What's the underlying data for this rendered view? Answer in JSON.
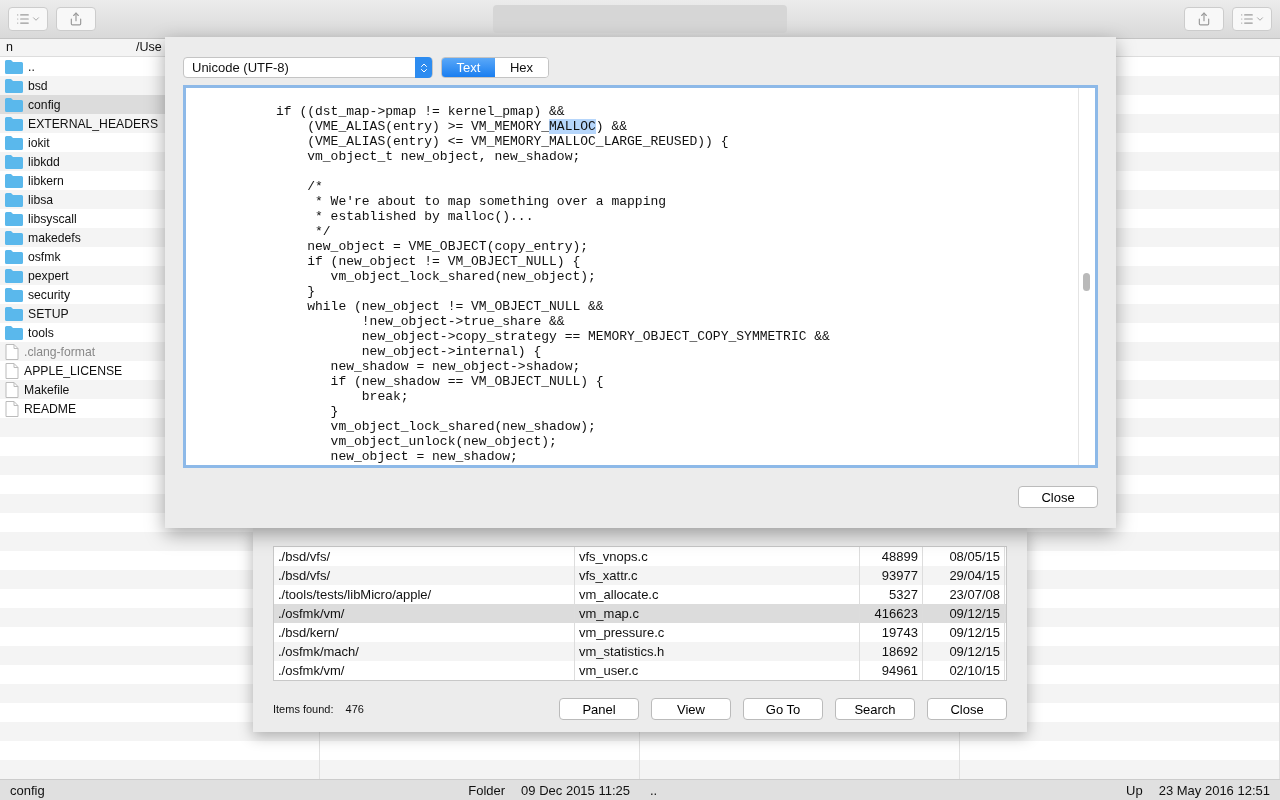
{
  "panel": {
    "header": {
      "name": "n",
      "path": "/Use"
    },
    "items": [
      {
        "kind": "folder",
        "name": "..",
        "selected": false,
        "hidden": false
      },
      {
        "kind": "folder",
        "name": "bsd",
        "selected": false,
        "hidden": false
      },
      {
        "kind": "folder",
        "name": "config",
        "selected": true,
        "hidden": false
      },
      {
        "kind": "folder",
        "name": "EXTERNAL_HEADERS",
        "selected": false,
        "hidden": false
      },
      {
        "kind": "folder",
        "name": "iokit",
        "selected": false,
        "hidden": false
      },
      {
        "kind": "folder",
        "name": "libkdd",
        "selected": false,
        "hidden": false
      },
      {
        "kind": "folder",
        "name": "libkern",
        "selected": false,
        "hidden": false
      },
      {
        "kind": "folder",
        "name": "libsa",
        "selected": false,
        "hidden": false
      },
      {
        "kind": "folder",
        "name": "libsyscall",
        "selected": false,
        "hidden": false
      },
      {
        "kind": "folder",
        "name": "makedefs",
        "selected": false,
        "hidden": false
      },
      {
        "kind": "folder",
        "name": "osfmk",
        "selected": false,
        "hidden": false
      },
      {
        "kind": "folder",
        "name": "pexpert",
        "selected": false,
        "hidden": false
      },
      {
        "kind": "folder",
        "name": "security",
        "selected": false,
        "hidden": false
      },
      {
        "kind": "folder",
        "name": "SETUP",
        "selected": false,
        "hidden": false
      },
      {
        "kind": "folder",
        "name": "tools",
        "selected": false,
        "hidden": false
      },
      {
        "kind": "file",
        "name": ".clang-format",
        "selected": false,
        "hidden": true
      },
      {
        "kind": "file",
        "name": "APPLE_LICENSE",
        "selected": false,
        "hidden": false
      },
      {
        "kind": "file",
        "name": "Makefile",
        "selected": false,
        "hidden": false
      },
      {
        "kind": "file",
        "name": "README",
        "selected": false,
        "hidden": false
      }
    ]
  },
  "status_bar": {
    "left_name": "config",
    "left_type": "Folder",
    "left_date": "09 Dec 2015 11:25",
    "right_name": "..",
    "right_type": "Up",
    "right_date": "23 May 2016 12:51"
  },
  "search_dialog": {
    "rows": [
      {
        "path": "./bsd/vfs/",
        "name": "vfs_vnops.c",
        "size": "48899",
        "date": "08/05/15",
        "selected": false
      },
      {
        "path": "./bsd/vfs/",
        "name": "vfs_xattr.c",
        "size": "93977",
        "date": "29/04/15",
        "selected": false
      },
      {
        "path": "./tools/tests/libMicro/apple/",
        "name": "vm_allocate.c",
        "size": "5327",
        "date": "23/07/08",
        "selected": false
      },
      {
        "path": "./osfmk/vm/",
        "name": "vm_map.c",
        "size": "416623",
        "date": "09/12/15",
        "selected": true
      },
      {
        "path": "./bsd/kern/",
        "name": "vm_pressure.c",
        "size": "19743",
        "date": "09/12/15",
        "selected": false
      },
      {
        "path": "./osfmk/mach/",
        "name": "vm_statistics.h",
        "size": "18692",
        "date": "09/12/15",
        "selected": false
      },
      {
        "path": "./osfmk/vm/",
        "name": "vm_user.c",
        "size": "94961",
        "date": "02/10/15",
        "selected": false
      }
    ],
    "items_label": "Items found:",
    "items_count": "476",
    "buttons": [
      "Panel",
      "View",
      "Go To",
      "Search",
      "Close"
    ]
  },
  "viewer": {
    "encoding": "Unicode (UTF-8)",
    "modes": [
      {
        "label": "Text",
        "selected": true
      },
      {
        "label": "Hex",
        "selected": false
      }
    ],
    "lines": [
      {
        "kind": "code",
        "text": "if ((dst_map->pmap != kernel_pmap) &&"
      },
      {
        "kind": "marked",
        "parts": [
          {
            "text": "    (VME_ALIAS(entry) >= VM_MEMORY_",
            "selected": false
          },
          {
            "text": "MALLOC",
            "selected": true
          },
          {
            "text": ") &&",
            "selected": false
          }
        ]
      },
      {
        "kind": "code",
        "text": "    (VME_ALIAS(entry) <= VM_MEMORY_MALLOC_LARGE_REUSED)) {"
      },
      {
        "kind": "code",
        "text": "    vm_object_t new_object, new_shadow;"
      },
      {
        "kind": "blank"
      },
      {
        "kind": "code",
        "text": "    /*"
      },
      {
        "kind": "code",
        "text": "     * We're about to map something over a mapping"
      },
      {
        "kind": "code",
        "text": "     * established by malloc()..."
      },
      {
        "kind": "code",
        "text": "     */"
      },
      {
        "kind": "code",
        "text": "    new_object = VME_OBJECT(copy_entry);"
      },
      {
        "kind": "code",
        "text": "    if (new_object != VM_OBJECT_NULL) {"
      },
      {
        "kind": "code",
        "text": "       vm_object_lock_shared(new_object);"
      },
      {
        "kind": "code",
        "text": "    }"
      },
      {
        "kind": "code",
        "text": "    while (new_object != VM_OBJECT_NULL &&"
      },
      {
        "kind": "code",
        "text": "           !new_object->true_share &&"
      },
      {
        "kind": "code",
        "text": "           new_object->copy_strategy == MEMORY_OBJECT_COPY_SYMMETRIC &&"
      },
      {
        "kind": "code",
        "text": "           new_object->internal) {"
      },
      {
        "kind": "code",
        "text": "       new_shadow = new_object->shadow;"
      },
      {
        "kind": "code",
        "text": "       if (new_shadow == VM_OBJECT_NULL) {"
      },
      {
        "kind": "code",
        "text": "           break;"
      },
      {
        "kind": "code",
        "text": "       }"
      },
      {
        "kind": "code",
        "text": "       vm_object_lock_shared(new_shadow);"
      },
      {
        "kind": "code",
        "text": "       vm_object_unlock(new_object);"
      },
      {
        "kind": "code",
        "text": "       new_object = new_shadow;"
      }
    ],
    "close": "Close"
  }
}
